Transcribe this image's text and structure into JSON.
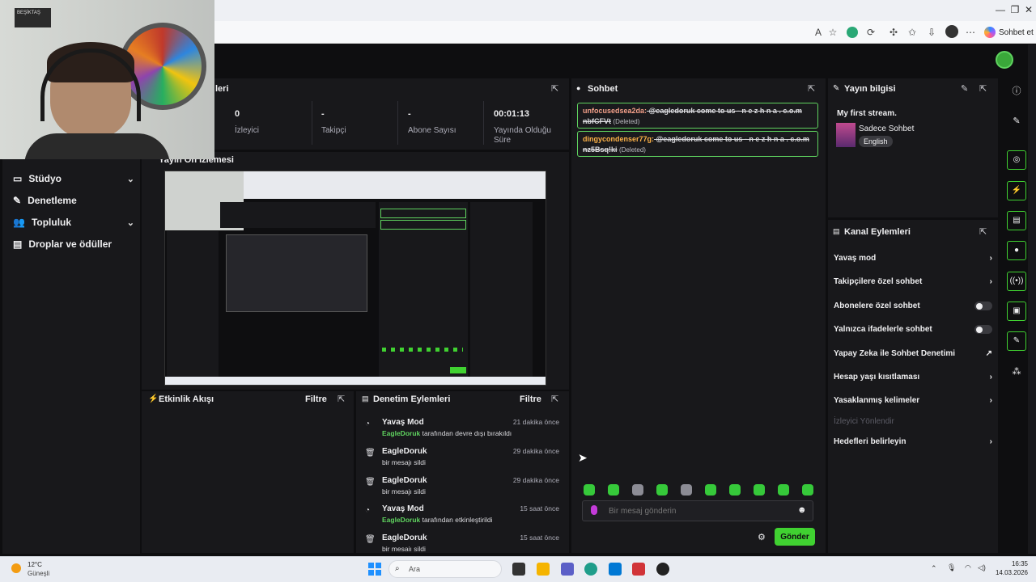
{
  "browser": {
    "window_controls": [
      "—",
      "❐",
      "✕"
    ],
    "sohbet_et": "Sohbet et"
  },
  "webcam": {
    "sign_text": "BEŞİKTAŞ"
  },
  "sidebar": {
    "items": [
      {
        "label": "Stüdyo",
        "icon": "studio-icon",
        "expandable": true
      },
      {
        "label": "Denetleme",
        "icon": "wrench-icon",
        "expandable": false
      },
      {
        "label": "Topluluk",
        "icon": "people-icon",
        "expandable": true
      },
      {
        "label": "Droplar ve ödüller",
        "icon": "drops-icon",
        "expandable": false
      }
    ]
  },
  "stream_stats": {
    "title_fragment": "leri",
    "stats": [
      {
        "value": "0",
        "label": "İzleyici"
      },
      {
        "value": "-",
        "label": "Takipçi"
      },
      {
        "value": "-",
        "label": "Abone Sayısı"
      },
      {
        "value": "00:01:13",
        "label": "Yayında Olduğu Süre"
      }
    ]
  },
  "preview": {
    "title": "Yayın Ön İzlemesi"
  },
  "activity": {
    "title": "Etkinlik Akışı",
    "filter": "Filtre"
  },
  "mod_actions": {
    "title": "Denetim Eylemleri",
    "filter": "Filtre",
    "items": [
      {
        "title": "Yavaş Mod",
        "time": "21 dakika önce",
        "user": "EagleDoruk",
        "desc": " tarafından devre dışı bırakıldı",
        "icon": "slow-mode-icon"
      },
      {
        "title": "EagleDoruk",
        "time": "29 dakika önce",
        "user": "",
        "desc": "bir mesajı sildi",
        "icon": "trash-icon"
      },
      {
        "title": "EagleDoruk",
        "time": "29 dakika önce",
        "user": "",
        "desc": "bir mesajı sildi",
        "icon": "trash-icon"
      },
      {
        "title": "Yavaş Mod",
        "time": "15 saat önce",
        "user": "EagleDoruk",
        "desc": " tarafından etkinleştirildi",
        "icon": "slow-mode-icon"
      },
      {
        "title": "EagleDoruk",
        "time": "15 saat önce",
        "user": "",
        "desc": "bir mesajı sildi",
        "icon": "trash-icon"
      }
    ]
  },
  "chat": {
    "title": "Sohbet",
    "messages": [
      {
        "user": "unfocusedsea2da:",
        "text": " @eagledoruk come to us - n e z h n a . c.o.m nbfCFVt",
        "deleted": "(Deleted)"
      },
      {
        "user": "dingycondenser77g:",
        "text": " @eagledoruk come to us - n e z h n a . c.o.m nz5Bsq!ki",
        "deleted": "(Deleted)"
      }
    ],
    "input_placeholder": "Bir mesaj gönderin",
    "send_label": "Gönder"
  },
  "stream_info": {
    "title": "Yayın bilgisi",
    "stream_title": "My first stream.",
    "category": "Sadece Sohbet",
    "language": "English"
  },
  "channel_actions": {
    "title": "Kanal Eylemleri",
    "items": [
      {
        "label": "Yavaş mod",
        "control": "chevron"
      },
      {
        "label": "Takipçilere özel sohbet",
        "control": "chevron"
      },
      {
        "label": "Abonelere özel sohbet",
        "control": "toggle",
        "on": false
      },
      {
        "label": "Yalnızca ifadelerle sohbet",
        "control": "toggle",
        "on": false
      },
      {
        "label": "Yapay Zeka ile Sohbet Denetimi",
        "control": "external"
      },
      {
        "label": "Hesap yaşı kısıtlaması",
        "control": "chevron"
      },
      {
        "label": "Yasaklanmış kelimeler",
        "control": "chevron"
      },
      {
        "label": "İzleyici Yönlendir",
        "control": "none",
        "disabled": true
      },
      {
        "label": "Hedefleri belirleyin",
        "control": "chevron"
      }
    ]
  },
  "taskbar": {
    "weather_temp": "12°C",
    "weather_desc": "Güneşli",
    "search": "Ara",
    "time": "16:35",
    "date": "14.03.2026"
  },
  "colors": {
    "accent": "#40d131",
    "panel": "#18181b",
    "bg": "#0e0e10"
  }
}
